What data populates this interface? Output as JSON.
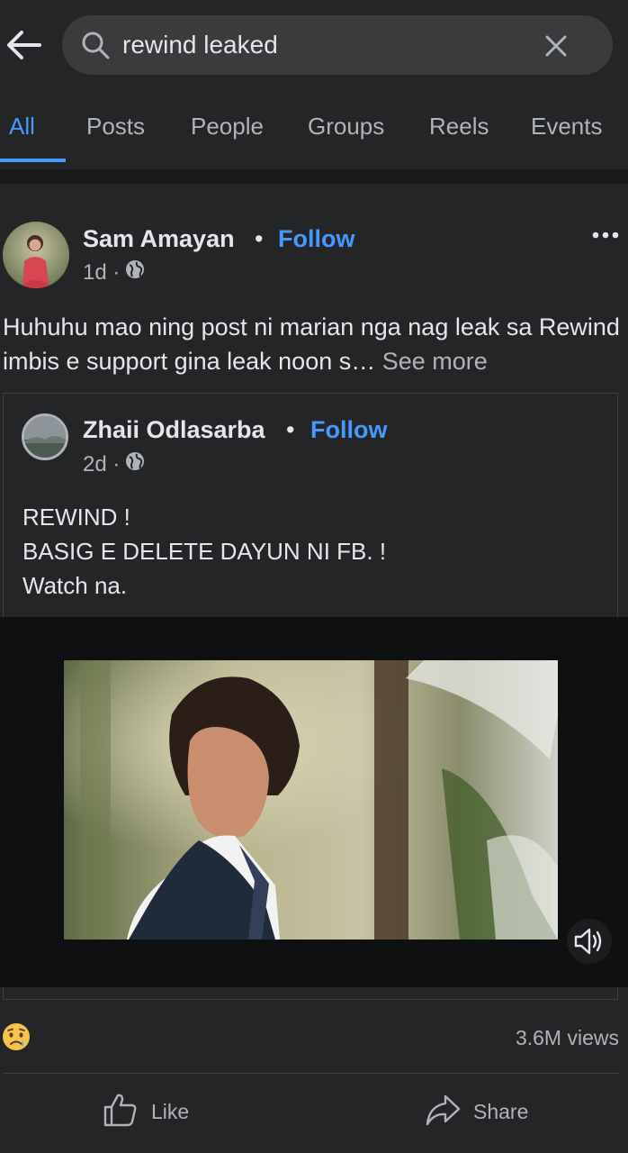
{
  "search": {
    "query": "rewind leaked"
  },
  "tabs": [
    "All",
    "Posts",
    "People",
    "Groups",
    "Reels",
    "Events"
  ],
  "post": {
    "author": "Sam Amayan",
    "separator": "•",
    "follow_label": "Follow",
    "time": "1d ·",
    "text": "Huhuhu mao ning post ni marian nga nag leak sa Rewind imbis e support gina leak noon s… ",
    "see_more": "See more"
  },
  "shared_post": {
    "author": "Zhaii Odlasarba",
    "separator": "•",
    "follow_label": "Follow",
    "time": "2d ·",
    "lines": [
      "REWIND !",
      "BASIG E DELETE DAYUN NI FB. !",
      "Watch na."
    ]
  },
  "stats": {
    "views": "3.6M views"
  },
  "actions": {
    "like": "Like",
    "share": "Share"
  },
  "colors": {
    "background": "#242526",
    "accent": "#4599ff",
    "text": "#e4e6eb",
    "muted": "#b0b3b8"
  }
}
